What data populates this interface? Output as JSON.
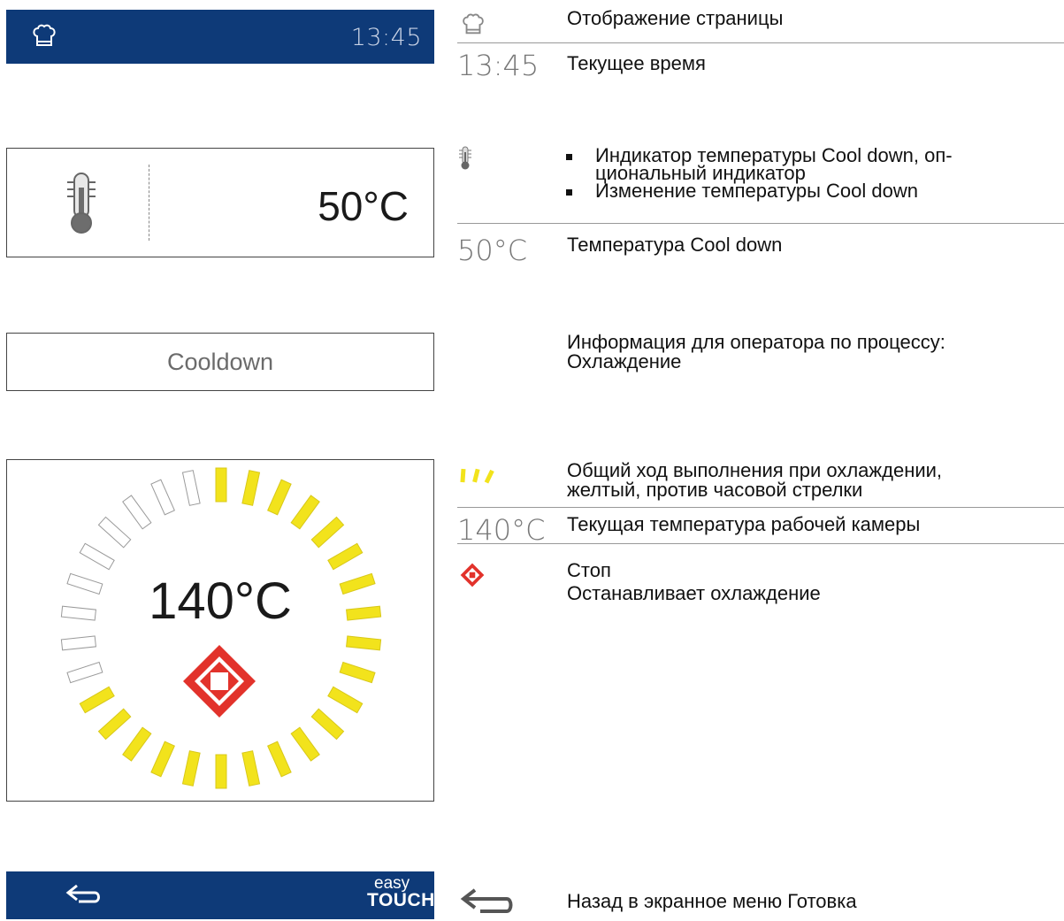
{
  "screen": {
    "header": {
      "time": "13:45",
      "page_icon": "chef-hat-icon"
    },
    "cooldown_temp": {
      "icon": "thermometer-icon",
      "value": "50°C"
    },
    "process_info": {
      "label": "Cooldown"
    },
    "progress": {
      "current_temp": "140°C",
      "segments_total": 30,
      "segments_filled": 21,
      "filled_color": "#f2e31c",
      "empty_color": "#ffffff",
      "stop_icon": "stop-icon"
    },
    "footer": {
      "back_icon": "back-arrow-icon",
      "logo_line1": "easy",
      "logo_line2": "TOUCH"
    }
  },
  "legend": {
    "page_display": "Отображение страницы",
    "time_sample": "13:45",
    "current_time": "Текущее время",
    "temp_indicator_bullets": [
      "Индикатор температуры Cool down, оп-\nциональный индикатор",
      "Изменение температуры Cool down"
    ],
    "cooldown_temp_sample": "50°C",
    "cooldown_temp": "Температура Cool down",
    "operator_info": "Информация для оператора по процессу:\nОхлаждение",
    "progress_desc": "Общий ход выполнения при охлаждении,\nжелтый, против часовой стрелки",
    "chamber_temp_sample": "140°C",
    "chamber_temp": "Текущая температура рабочей камеры",
    "stop_title": "Стоп",
    "stop_desc": "Останавливает охлаждение",
    "back_desc": "Назад в экранное меню Готовка"
  },
  "colors": {
    "bar_blue": "#0e3a78",
    "yellow": "#f2e31c",
    "stop_red": "#e2322b"
  }
}
